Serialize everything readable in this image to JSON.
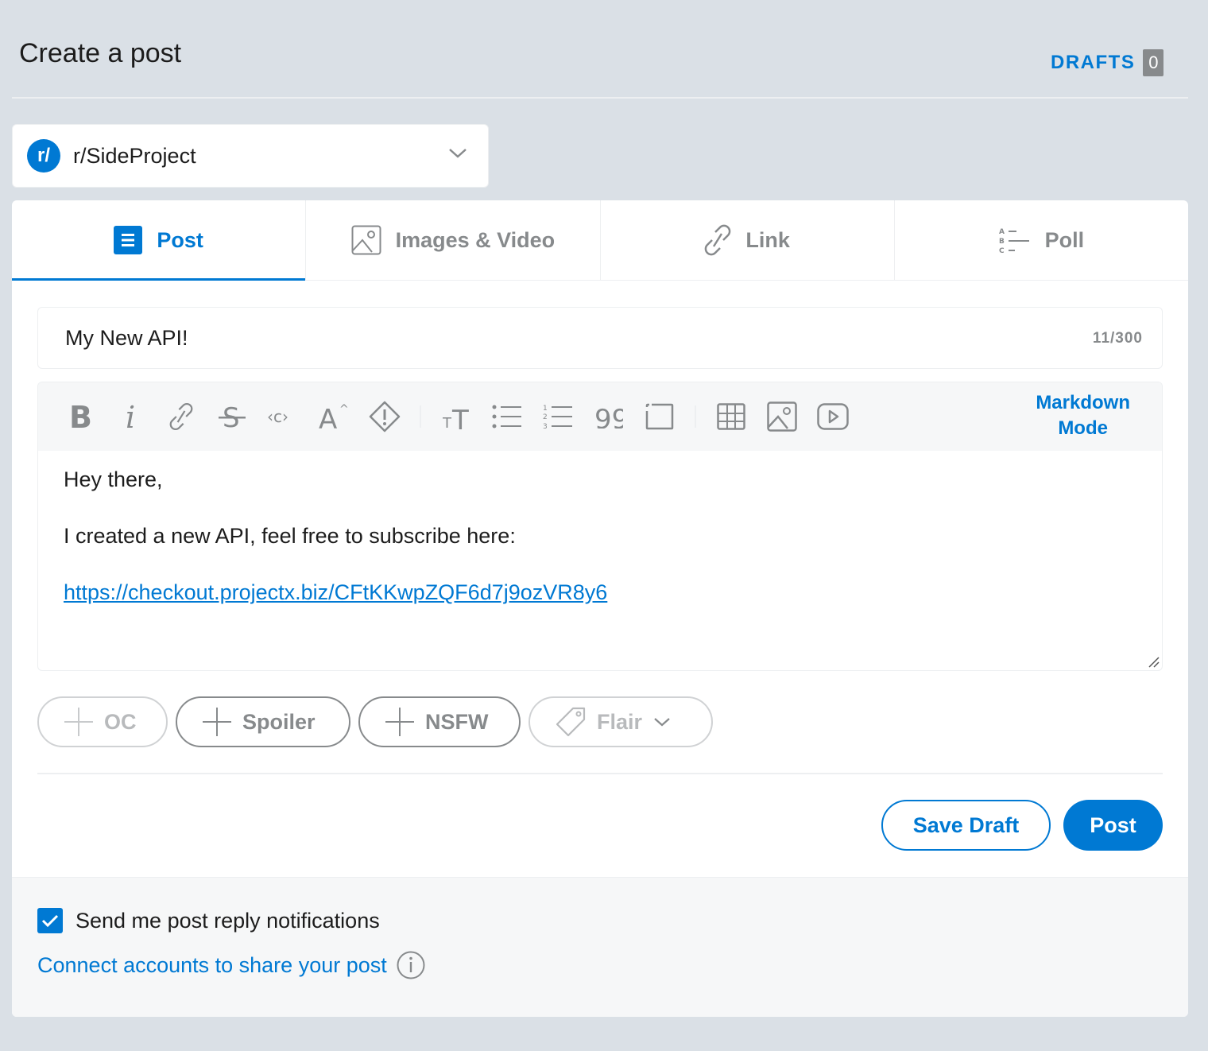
{
  "header": {
    "title": "Create a post",
    "drafts_label": "DRAFTS",
    "drafts_count": "0"
  },
  "community": {
    "avatar_text": "r/",
    "name": "r/SideProject"
  },
  "tabs": [
    {
      "label": "Post",
      "icon": "post-icon",
      "active": true
    },
    {
      "label": "Images & Video",
      "icon": "image-icon",
      "active": false
    },
    {
      "label": "Link",
      "icon": "link-icon",
      "active": false
    },
    {
      "label": "Poll",
      "icon": "poll-icon",
      "active": false
    }
  ],
  "title_input": {
    "value": "My New API!",
    "char_count": "11/300"
  },
  "editor": {
    "markdown_mode_line1": "Markdown",
    "markdown_mode_line2": "Mode",
    "paragraph1": "Hey there,",
    "paragraph2": "I created a new API, feel free to subscribe here:",
    "link": "https://checkout.projectx.biz/CFtKKwpZQF6d7j9ozVR8y6"
  },
  "tags": {
    "oc": "OC",
    "spoiler": "Spoiler",
    "nsfw": "NSFW",
    "flair": "Flair"
  },
  "actions": {
    "save_draft": "Save Draft",
    "post": "Post"
  },
  "footer": {
    "notify_label": "Send me post reply notifications",
    "notify_checked": true,
    "connect_label": "Connect accounts to share your post"
  },
  "colors": {
    "accent": "#0079d3",
    "page_bg": "#dae0e6",
    "muted": "#878a8c"
  }
}
